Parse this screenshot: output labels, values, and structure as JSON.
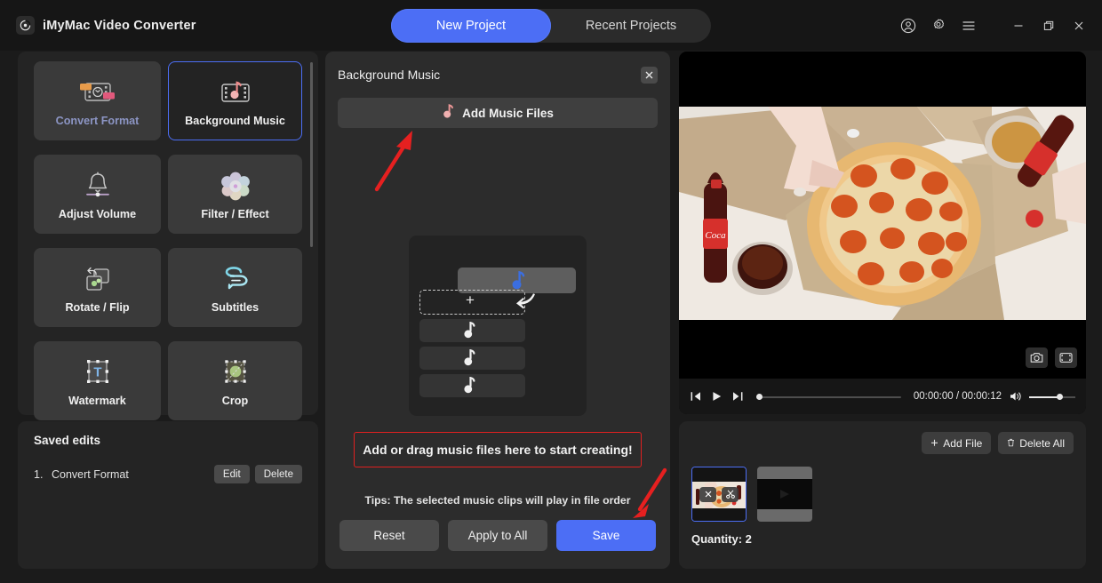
{
  "app": {
    "title": "iMyMac Video Converter",
    "logo_icon": "disc-icon"
  },
  "tabs": [
    {
      "label": "New Project",
      "active": true
    },
    {
      "label": "Recent Projects",
      "active": false
    }
  ],
  "titlebar_icons": [
    {
      "name": "account-icon"
    },
    {
      "name": "gear-icon"
    },
    {
      "name": "menu-icon"
    },
    {
      "name": "minimize-icon"
    },
    {
      "name": "restore-icon"
    },
    {
      "name": "close-icon"
    }
  ],
  "sidebar": {
    "tools": [
      {
        "label": "Convert Format",
        "icon": "convert-format-icon",
        "selected": false,
        "dim": true
      },
      {
        "label": "Background Music",
        "icon": "background-music-icon",
        "selected": true,
        "dim": false
      },
      {
        "label": "Adjust Volume",
        "icon": "adjust-volume-icon",
        "selected": false,
        "dim": false
      },
      {
        "label": "Filter / Effect",
        "icon": "filter-effect-icon",
        "selected": false,
        "dim": false
      },
      {
        "label": "Rotate / Flip",
        "icon": "rotate-flip-icon",
        "selected": false,
        "dim": false
      },
      {
        "label": "Subtitles",
        "icon": "subtitles-icon",
        "selected": false,
        "dim": false
      },
      {
        "label": "Watermark",
        "icon": "watermark-icon",
        "selected": false,
        "dim": false
      },
      {
        "label": "Crop",
        "icon": "crop-icon",
        "selected": false,
        "dim": false
      }
    ]
  },
  "saved_edits": {
    "title": "Saved edits",
    "rows": [
      {
        "index": "1.",
        "name": "Convert Format",
        "edit_label": "Edit",
        "delete_label": "Delete"
      }
    ]
  },
  "center": {
    "title": "Background Music",
    "close_icon": "close-icon",
    "add_music_label": "Add Music Files",
    "add_music_icon": "music-note-icon",
    "drag_hint": "Add or drag music files here to start creating!",
    "tips": "Tips: The selected music clips will play in file order",
    "buttons": {
      "reset": "Reset",
      "apply_to_all": "Apply to All",
      "save": "Save"
    }
  },
  "preview": {
    "snapshot_icon": "camera-icon",
    "fullscreen_icon": "expand-icon",
    "prev_icon": "skip-back-icon",
    "play_icon": "play-icon",
    "next_icon": "skip-forward-icon",
    "volume_icon": "speaker-icon",
    "current_time": "00:00:00",
    "total_time": "00:00:12",
    "timecode": "00:00:00 / 00:00:12",
    "seek_percent": 0,
    "volume_percent": 62
  },
  "filelist": {
    "add_file_label": "Add File",
    "add_file_icon": "plus-icon",
    "delete_all_label": "Delete All",
    "delete_all_icon": "trash-icon",
    "quantity_label": "Quantity: 2",
    "thumbs": [
      {
        "selected": true,
        "close_icon": "close-icon",
        "cut_icon": "scissors-icon"
      },
      {
        "selected": false
      }
    ]
  },
  "annotations": {
    "arrow_color": "#e62020",
    "highlight_color": "#e02020"
  },
  "colors": {
    "accent": "#4c6ef5",
    "panel": "#242424",
    "center_panel": "#2c2c2c",
    "tool": "#3a3a3a",
    "background": "#1b1b1b",
    "titlebar": "#161616"
  }
}
